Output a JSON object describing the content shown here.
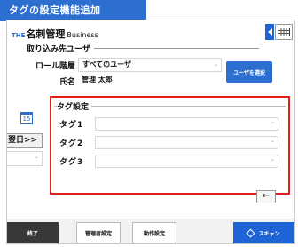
{
  "banner": {
    "title": "タグの設定機能追加"
  },
  "brand": {
    "the": "THE",
    "name": "名刺管理",
    "sub": "Business"
  },
  "user_section": {
    "title": "取り込み先ユーザ",
    "role_label": "ロール階層",
    "role_value": "すべてのユーザ",
    "name_label": "氏名",
    "name_value": "管理 太郎",
    "select_user_button": "ユーザを選択"
  },
  "left_panel": {
    "calendar_day": "15",
    "next_day_button": "翌日>>"
  },
  "tag_settings": {
    "title": "タグ設定",
    "rows": [
      {
        "label": "タグ1",
        "value": ""
      },
      {
        "label": "タグ2",
        "value": ""
      },
      {
        "label": "タグ3",
        "value": ""
      }
    ]
  },
  "nav": {
    "back_arrow": "←"
  },
  "footer": {
    "end_button": "終了",
    "admin_settings_button": "管理者設定",
    "action_settings_button": "動作設定",
    "scan_button": "スキャン"
  },
  "colors": {
    "accent": "#2d6fd1",
    "highlight_border": "#e21b1b",
    "footer_dark": "#383838"
  }
}
